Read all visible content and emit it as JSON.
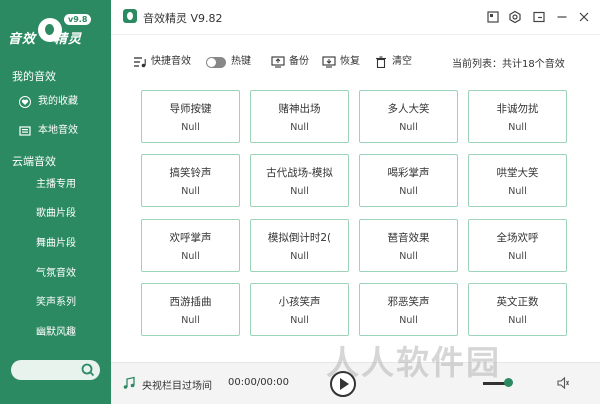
{
  "colors": {
    "brand": "#2c8a62",
    "card_border": "#9dd3b8",
    "sidebar_text": "#ffffff"
  },
  "sidebar": {
    "logo_text_a": "音效",
    "logo_text_b": "精灵",
    "logo_version": "v9.8",
    "sections": [
      {
        "label": "我的音效"
      },
      {
        "label": "云端音效"
      }
    ],
    "my_items": [
      {
        "label": "我的收藏",
        "icon": "heart-icon"
      },
      {
        "label": "本地音效",
        "icon": "folder-icon"
      }
    ],
    "cloud_items": [
      {
        "label": "主播专用"
      },
      {
        "label": "歌曲片段"
      },
      {
        "label": "舞曲片段"
      },
      {
        "label": "气氛音效"
      },
      {
        "label": "笑声系列"
      },
      {
        "label": "幽默风趣"
      }
    ]
  },
  "titlebar": {
    "title": "音效精灵 V9.82"
  },
  "toolbar": {
    "shortcut_label": "快捷音效",
    "hotkey_label": "热键",
    "backup_label": "备份",
    "restore_label": "恢复",
    "clear_label": "清空",
    "count_label": "当前列表：共计18个音效"
  },
  "sounds": [
    {
      "name": "导师按键",
      "value": "Null"
    },
    {
      "name": "赌神出场",
      "value": "Null"
    },
    {
      "name": "多人大笑",
      "value": "Null"
    },
    {
      "name": "非诚勿扰",
      "value": "Null"
    },
    {
      "name": "搞笑铃声",
      "value": "Null"
    },
    {
      "name": "古代战场-模拟",
      "value": "Null"
    },
    {
      "name": "喝彩掌声",
      "value": "Null"
    },
    {
      "name": "哄堂大笑",
      "value": "Null"
    },
    {
      "name": "欢呼掌声",
      "value": "Null"
    },
    {
      "name": "模拟倒计时2(",
      "value": "Null"
    },
    {
      "name": "琶音效果",
      "value": "Null"
    },
    {
      "name": "全场欢呼",
      "value": "Null"
    },
    {
      "name": "西游插曲",
      "value": "Null"
    },
    {
      "name": "小孩笑声",
      "value": "Null"
    },
    {
      "name": "邪恶笑声",
      "value": "Null"
    },
    {
      "name": "英文正数",
      "value": "Null"
    }
  ],
  "player": {
    "now_playing": "央视栏目过场间",
    "time": "00:00/00:00"
  },
  "watermark": "人人软件园"
}
